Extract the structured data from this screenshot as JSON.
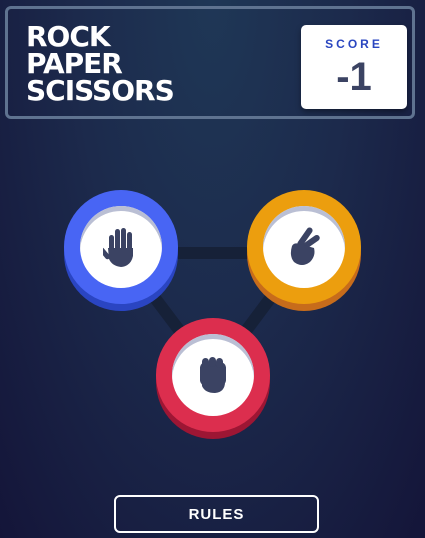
{
  "header": {
    "title_lines": [
      "ROCK",
      "PAPER",
      "SCISSORS"
    ],
    "score_label": "SCORE",
    "score_value": "-1"
  },
  "tokens": [
    {
      "id": "paper",
      "icon": "hand-paper-icon",
      "color": "#4865f4"
    },
    {
      "id": "scissors",
      "icon": "hand-scissors-icon",
      "color": "#ec9e0e"
    },
    {
      "id": "rock",
      "icon": "hand-rock-icon",
      "color": "#dc2e4e"
    }
  ],
  "footer": {
    "rules_label": "RULES"
  }
}
